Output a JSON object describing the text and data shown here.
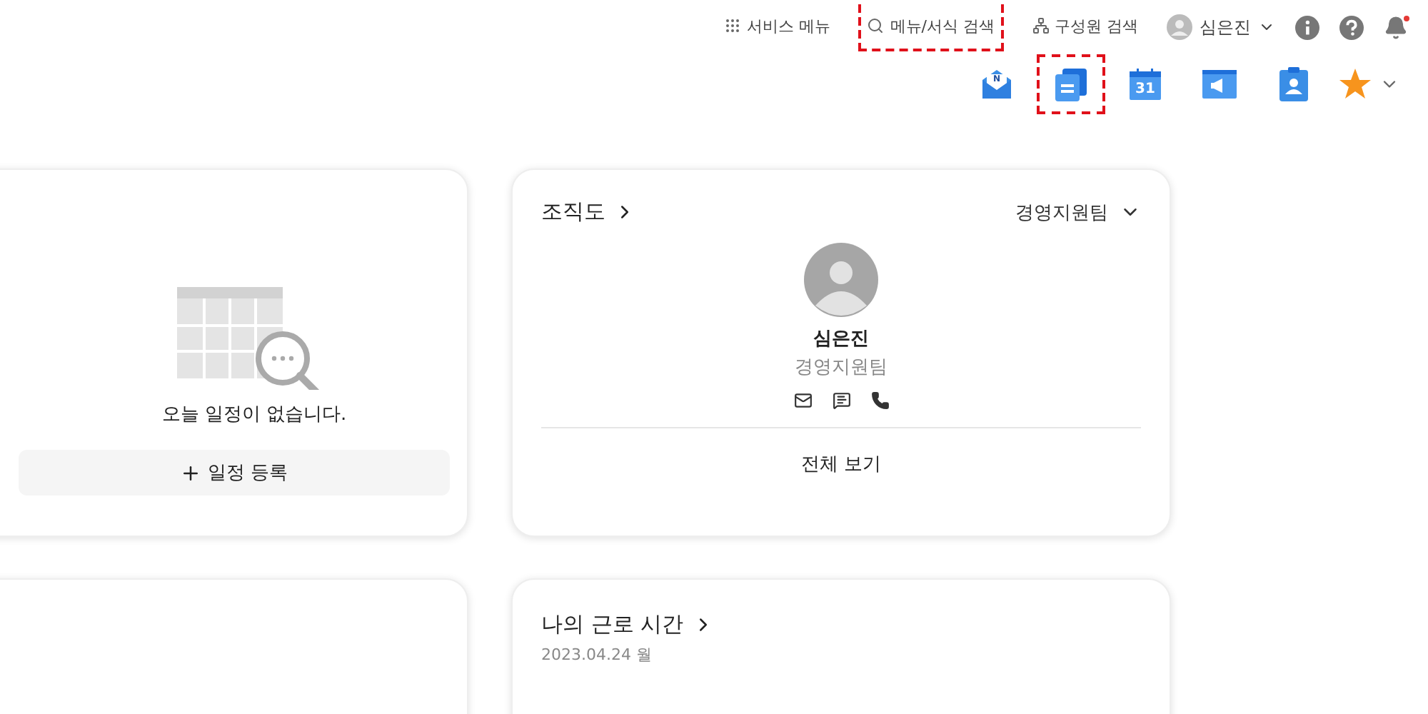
{
  "header": {
    "links": [
      {
        "kind": "menu",
        "label": "서비스 메뉴",
        "highlighted": false
      },
      {
        "kind": "search",
        "label": "메뉴/서식 검색",
        "highlighted": true
      },
      {
        "kind": "org",
        "label": "구성원 검색",
        "highlighted": false
      }
    ],
    "user": {
      "name": "심은진"
    },
    "notification_badge": true
  },
  "apps": [
    {
      "kind": "mail",
      "badge": "N",
      "highlighted": false
    },
    {
      "kind": "docs",
      "highlighted": true
    },
    {
      "kind": "calendar",
      "badge": "31",
      "highlighted": false
    },
    {
      "kind": "notice",
      "highlighted": false
    },
    {
      "kind": "contacts",
      "highlighted": false
    },
    {
      "kind": "favorites",
      "highlighted": false
    }
  ],
  "schedule_card": {
    "message": "오늘 일정이 없습니다.",
    "add_button": "일정 등록"
  },
  "org_card": {
    "title": "조직도",
    "team_select": "경영지원팀",
    "person": {
      "name": "심은진",
      "team": "경영지원팀"
    },
    "view_all": "전체 보기"
  },
  "work_time_card": {
    "title": "나의 근로 시간",
    "date": "2023.04.24 월"
  }
}
